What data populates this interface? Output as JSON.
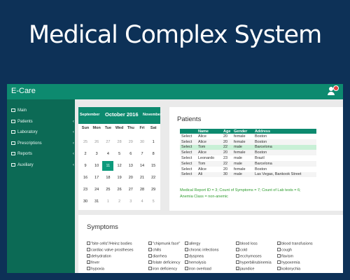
{
  "banner": {
    "title": "Medical Complex System"
  },
  "app": {
    "brand": "E-Care",
    "colors": {
      "primary": "#0d8a6f",
      "sidebar": "#0c6a55",
      "selected_row": "#c8f0d6",
      "report_text": "#2c9c2c"
    },
    "user_icon": "user-icon",
    "notification_icon": "notification-badge-icon"
  },
  "sidebar": {
    "items": [
      {
        "label": "Main",
        "icon": "monitor-icon",
        "has_submenu": false
      },
      {
        "label": "Patients",
        "icon": "list-icon",
        "has_submenu": true
      },
      {
        "label": "Laboratory",
        "icon": "flask-icon",
        "has_submenu": true
      },
      {
        "label": "Prescriptions",
        "icon": "edit-icon",
        "has_submenu": true
      },
      {
        "label": "Reports",
        "icon": "table-icon",
        "has_submenu": true
      },
      {
        "label": "Auxiliary",
        "icon": "warning-icon",
        "has_submenu": true
      }
    ]
  },
  "calendar": {
    "prev_month": "September",
    "current_month": "October 2016",
    "next_month": "November",
    "weekdays": [
      "Sun",
      "Mon",
      "Tue",
      "Wed",
      "Thu",
      "Fri",
      "Sat"
    ],
    "weeks": [
      [
        "25",
        "26",
        "27",
        "28",
        "29",
        "30",
        "1"
      ],
      [
        "2",
        "3",
        "4",
        "5",
        "6",
        "7",
        "8"
      ],
      [
        "9",
        "10",
        "11",
        "12",
        "13",
        "14",
        "15"
      ],
      [
        "16",
        "17",
        "18",
        "19",
        "20",
        "21",
        "22"
      ],
      [
        "23",
        "24",
        "25",
        "26",
        "27",
        "28",
        "29"
      ],
      [
        "30",
        "31",
        "1",
        "2",
        "3",
        "4",
        "5"
      ]
    ],
    "selected_day": "11"
  },
  "patients": {
    "title": "Patients",
    "columns": [
      "",
      "Name",
      "Age",
      "Gender",
      "Address"
    ],
    "rows": [
      {
        "action": "Select",
        "name": "Alice",
        "age": "20",
        "gender": "female",
        "address": "Boston"
      },
      {
        "action": "Select",
        "name": "Alice",
        "age": "20",
        "gender": "female",
        "address": "Boston"
      },
      {
        "action": "Select",
        "name": "Tom",
        "age": "22",
        "gender": "male",
        "address": "Barcelona",
        "selected": true
      },
      {
        "action": "Select",
        "name": "Alice",
        "age": "20",
        "gender": "female",
        "address": "Boston"
      },
      {
        "action": "Select",
        "name": "Leonardo",
        "age": "23",
        "gender": "male",
        "address": "Brazil"
      },
      {
        "action": "Select",
        "name": "Tom",
        "age": "22",
        "gender": "male",
        "address": "Barcelona"
      },
      {
        "action": "Select",
        "name": "Alice",
        "age": "20",
        "gender": "female",
        "address": "Boston"
      },
      {
        "action": "Select",
        "name": "Ali",
        "age": "30",
        "gender": "male",
        "address": "Las Vegas, Bankook Street"
      }
    ],
    "report": "Medical Report ID = 3; Count of Symptoms = 7; Count of Lab tests = 6; Anemia Class = non-anemic"
  },
  "symptoms": {
    "title": "Symptoms",
    "columns": [
      [
        {
          "label": "\"bite cells\"/Heinz bodies",
          "checked": false
        },
        {
          "label": "cardiac valve prostheses",
          "checked": false
        },
        {
          "label": "dehydration",
          "checked": true
        },
        {
          "label": "fever",
          "checked": true
        },
        {
          "label": "hypoxia",
          "checked": false
        }
      ],
      [
        {
          "label": "\"chipmunk face\"",
          "checked": true
        },
        {
          "label": "chills",
          "checked": false
        },
        {
          "label": "diarrhea",
          "checked": false
        },
        {
          "label": "folate deficiency",
          "checked": false
        },
        {
          "label": "iron deficiency",
          "checked": false
        }
      ],
      [
        {
          "label": "allergy",
          "checked": false
        },
        {
          "label": "chronic infections",
          "checked": false
        },
        {
          "label": "dyspnea",
          "checked": false
        },
        {
          "label": "hemolysis",
          "checked": false
        },
        {
          "label": "iron overload",
          "checked": false
        }
      ],
      [
        {
          "label": "blood loss",
          "checked": false
        },
        {
          "label": "cold",
          "checked": false
        },
        {
          "label": "ecchymoses",
          "checked": false
        },
        {
          "label": "hyperbilirubinemia",
          "checked": false
        },
        {
          "label": "jaundice",
          "checked": true
        }
      ],
      [
        {
          "label": "blood transfusions",
          "checked": true
        },
        {
          "label": "cough",
          "checked": false
        },
        {
          "label": "flavism",
          "checked": false
        },
        {
          "label": "hypoxemia",
          "checked": false
        },
        {
          "label": "koilonychia",
          "checked": false
        }
      ]
    ]
  }
}
